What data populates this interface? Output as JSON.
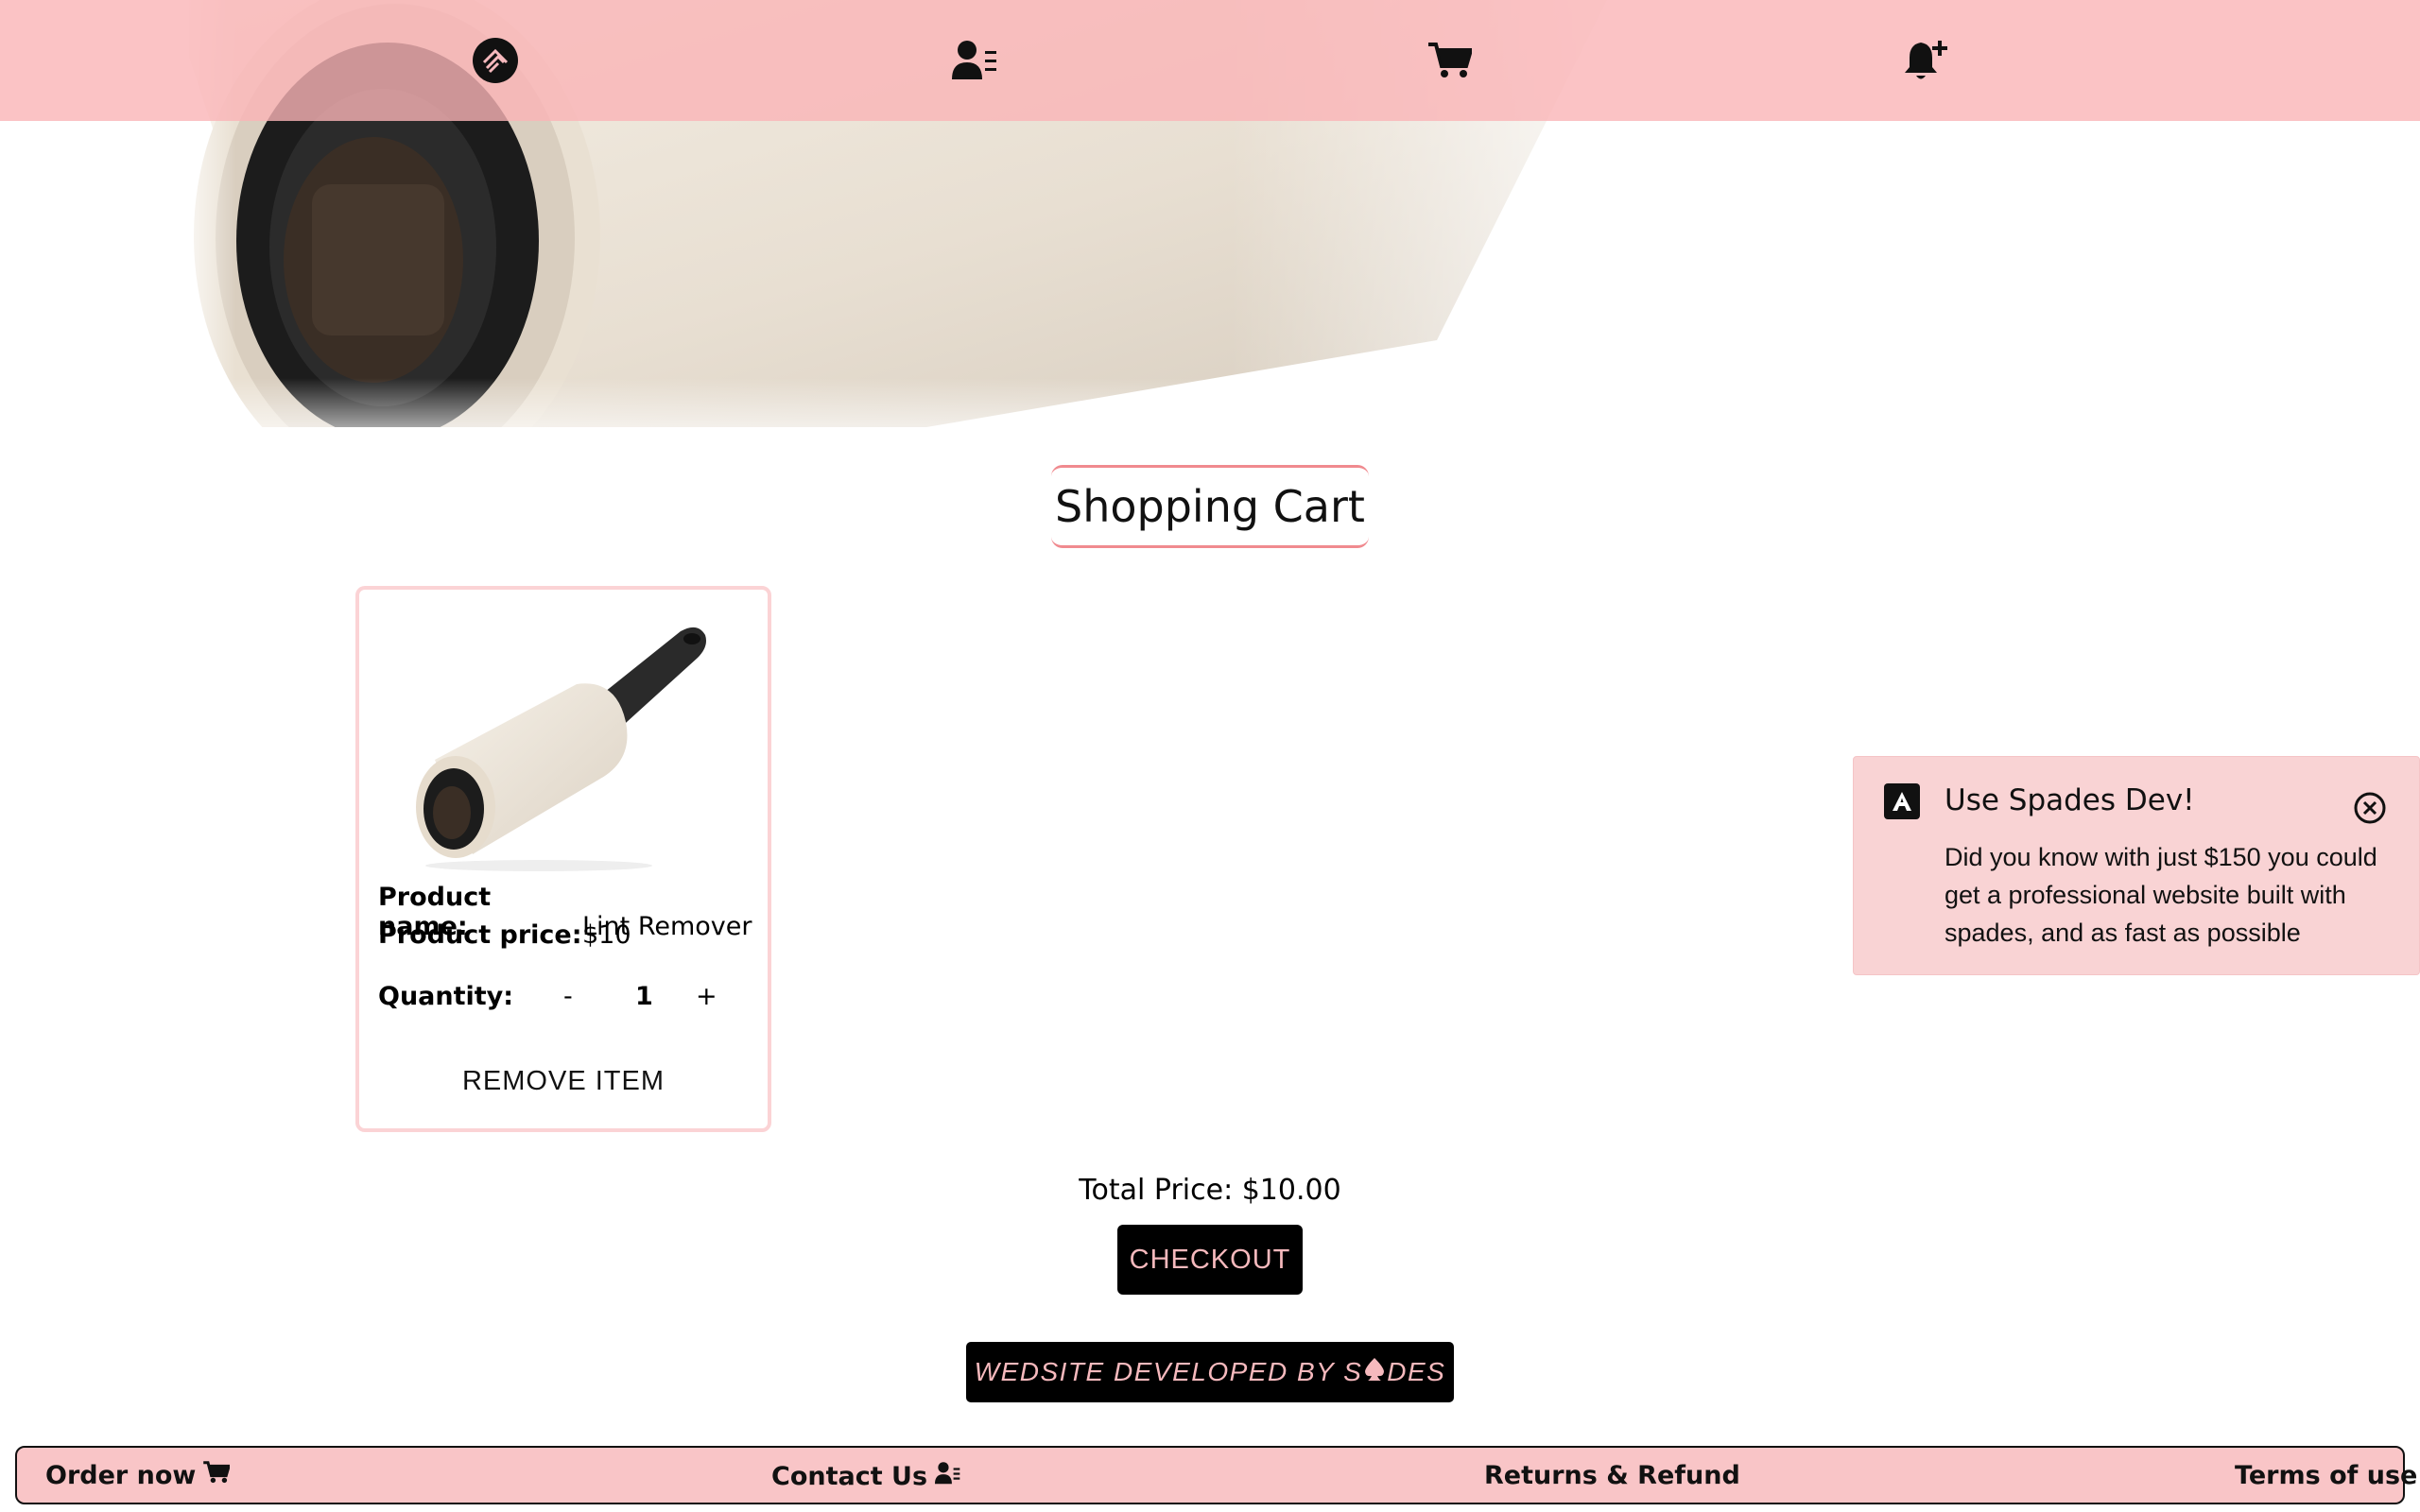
{
  "nav": {
    "items": [
      {
        "icon": "logo-icon"
      },
      {
        "icon": "contact-card-icon"
      },
      {
        "icon": "cart-icon"
      },
      {
        "icon": "bell-plus-icon"
      }
    ]
  },
  "colors": {
    "accent_pink": "#f9c5c7",
    "accent_border": "#f08a8f",
    "dark": "#000000",
    "button_text": "#f6b9bd"
  },
  "page": {
    "title": "Shopping Cart"
  },
  "cart": {
    "items": [
      {
        "image_icon": "lint-roller-image",
        "name_label": "Product name:",
        "name": "Lint Remover",
        "price_label": "Product price:",
        "price": "$10",
        "quantity_label": "Quantity:",
        "decrement": "-",
        "quantity": "1",
        "increment": "+",
        "remove_label": "REMOVE ITEM"
      }
    ],
    "total_text": "Total Price: $10.00",
    "checkout_label": "CHECKOUT"
  },
  "developer_badge": {
    "text_before": "WEDSITE DEVELOPED BY S",
    "text_after": "DES",
    "icon": "spade-icon"
  },
  "toast": {
    "title": "Use Spades Dev!",
    "body": "Did you know with just $150 you could get a professional website built with spades, and as fast as possible",
    "logo_icon": "a-logo-icon",
    "close_icon": "close-circle-icon"
  },
  "footer": {
    "order_label": "Order now",
    "contact_label": "Contact Us",
    "returns_label": "Returns & Refund",
    "terms_label": "Terms of use"
  }
}
